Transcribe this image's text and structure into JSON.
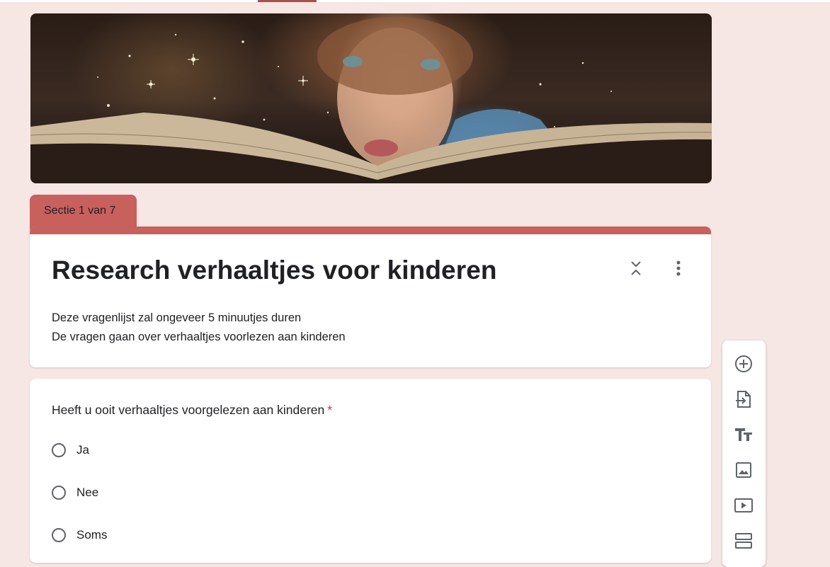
{
  "section": {
    "label": "Sectie 1 van 7"
  },
  "form": {
    "title": "Research verhaaltjes voor kinderen",
    "description_line1": "Deze vragenlijst zal ongeveer 5 minuutjes duren",
    "description_line2": "De vragen gaan over verhaaltjes voorlezen aan kinderen"
  },
  "question": {
    "text": "Heeft u ooit verhaaltjes voorgelezen aan kinderen",
    "required_mark": "*",
    "options": [
      "Ja",
      "Nee",
      "Soms"
    ]
  },
  "toolbar": {
    "icons": [
      "add-question-icon",
      "import-questions-icon",
      "add-title-icon",
      "add-image-icon",
      "add-video-icon",
      "add-section-icon"
    ]
  },
  "colors": {
    "accent": "#c8605e",
    "background": "#f6e6e4",
    "required": "#d93025"
  }
}
